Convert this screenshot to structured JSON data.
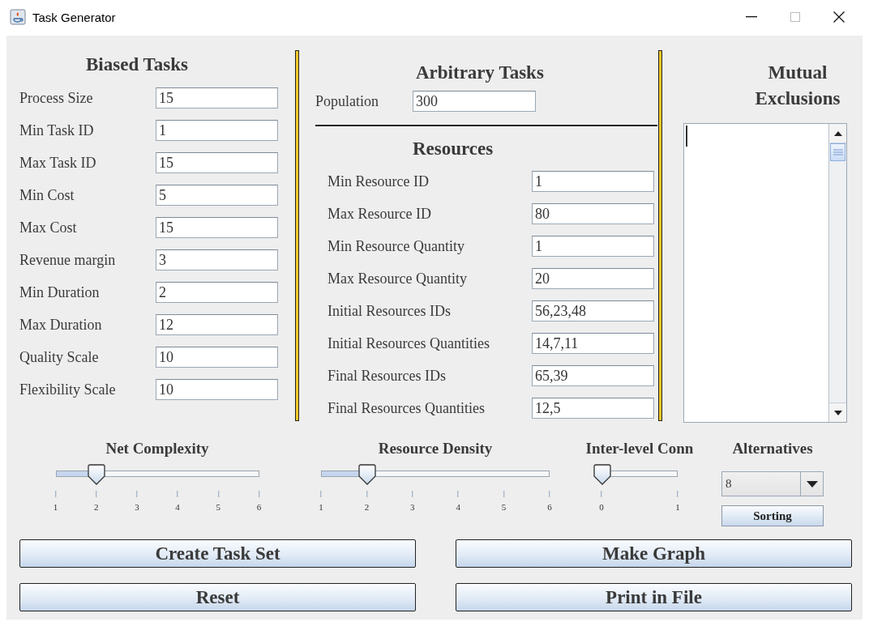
{
  "window": {
    "title": "Task Generator"
  },
  "biased_tasks": {
    "title": "Biased Tasks",
    "fields": [
      {
        "label": "Process Size",
        "value": "15"
      },
      {
        "label": "Min Task ID",
        "value": "1"
      },
      {
        "label": "Max Task ID",
        "value": "15"
      },
      {
        "label": "Min Cost",
        "value": "5"
      },
      {
        "label": "Max Cost",
        "value": "15"
      },
      {
        "label": "Revenue margin",
        "value": "3"
      },
      {
        "label": "Min Duration",
        "value": "2"
      },
      {
        "label": "Max Duration",
        "value": "12"
      },
      {
        "label": "Quality Scale",
        "value": "10"
      },
      {
        "label": "Flexibility Scale",
        "value": "10"
      }
    ]
  },
  "arbitrary_tasks": {
    "title": "Arbitrary Tasks",
    "fields": [
      {
        "label": "Population",
        "value": "300"
      }
    ]
  },
  "resources": {
    "title": "Resources",
    "fields": [
      {
        "label": "Min Resource ID",
        "value": "1"
      },
      {
        "label": "Max Resource ID",
        "value": "80"
      },
      {
        "label": "Min Resource Quantity",
        "value": "1"
      },
      {
        "label": "Max Resource Quantity",
        "value": "20"
      },
      {
        "label": "Initial Resources IDs",
        "value": "56,23,48"
      },
      {
        "label": "Initial Resources Quantities",
        "value": "14,7,11"
      },
      {
        "label": "Final Resources IDs",
        "value": "65,39"
      },
      {
        "label": "Final Resources Quantities",
        "value": "12,5"
      }
    ]
  },
  "mutual_exclusions": {
    "title": "Mutual Exclusions"
  },
  "sliders": [
    {
      "label": "Net Complexity",
      "level": 0.2,
      "ticks": [
        "1",
        "2",
        "3",
        "4",
        "5",
        "6"
      ]
    },
    {
      "label": "Resource Density",
      "level": 0.2,
      "ticks": [
        "1",
        "2",
        "3",
        "4",
        "5",
        "6"
      ]
    },
    {
      "label": "Inter-level Conn",
      "level": 0,
      "ticks": [
        "0",
        "1"
      ]
    }
  ],
  "alternatives": {
    "label": "Alternatives",
    "value": "8",
    "button": "Sorting"
  },
  "buttons": [
    "Create Task Set",
    "Make Graph",
    "Reset",
    "Print in File"
  ]
}
